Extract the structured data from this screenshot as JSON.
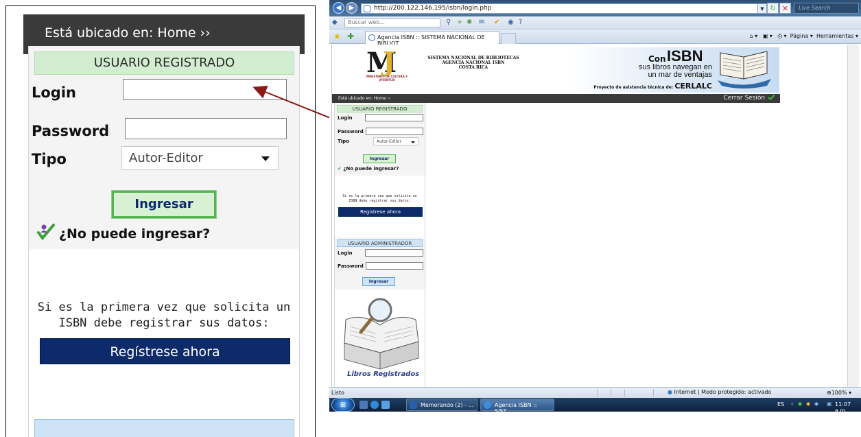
{
  "zoom": {
    "breadcrumb": "Está ubicado en: Home ››",
    "section_title": "USUARIO REGISTRADO",
    "login_label": "Login",
    "login_value": "",
    "password_label": "Password",
    "password_value": "",
    "tipo_label": "Tipo",
    "tipo_selected": "Autor-Editor",
    "submit_label": "Ingresar",
    "help_link": "¿No puede ingresar?",
    "info_line1": "Si es la primera vez que solicita un",
    "info_line2": "ISBN debe registrar sus datos:",
    "register_label": "Regístrese ahora"
  },
  "browser": {
    "url": "http://200.122.146.195/isbn/login.php",
    "search_placeholder": "Live Search",
    "toolbar_search_placeholder": "Buscar web...",
    "tab_title": "Agencia ISBN :: SISTEMA NACIONAL DE BIBLIOT...",
    "command_pagina": "Página",
    "command_herramientas": "Herramientas",
    "status_text": "Listo",
    "zone_text": "Internet | Modo protegido: activado",
    "zoom_level": "100%"
  },
  "page": {
    "logo_caption": "MINISTERIO DE CULTURA Y JUVENTUD",
    "org_line1": "SISTEMA NACIONAL DE BIBLIOTECAS",
    "org_line2": "AGENCIA NACIONAL ISBN",
    "org_line3": "COSTA RICA",
    "ad_con": "Con",
    "ad_isbn": "ISBN",
    "ad_line1": "sus libros navegan en",
    "ad_line2": "un mar de ventajas",
    "ad_project": "Proyecto de asistencia técnica de:",
    "ad_cerlalc": "CERLALC",
    "breadcrumb": "Está ubicado en: Home ››",
    "close_session": "Cerrar Sesión",
    "user_title": "USUARIO REGISTRADO",
    "login_label": "Login",
    "password_label": "Password",
    "tipo_label": "Tipo",
    "tipo_selected": "Autor-Editor",
    "submit_label": "Ingresar",
    "help_link": "¿No puede ingresar?",
    "info_line1": "Si es la primera vez que solicita un",
    "info_line2": "ISBN debe registrar sus datos:",
    "register_label": "Registrese ahora",
    "admin_title": "USUARIO ADMINISTRADOR",
    "admin_login_label": "Login",
    "admin_password_label": "Password",
    "admin_submit_label": "Ingresar",
    "libros_label": "Libros Registrados"
  },
  "taskbar": {
    "task1": "Memorando (2) - ...",
    "task2": "Agencia ISBN :: SIST...",
    "lang": "ES",
    "time": "11:07 a.m."
  },
  "colors": {
    "breadcrumb_bg": "#3a3a3a",
    "registered_header_bg": "#d2edcf",
    "admin_header_bg": "#cfe3f7",
    "register_button_bg": "#0d2a6a",
    "arrow": "#8b1a1a"
  }
}
